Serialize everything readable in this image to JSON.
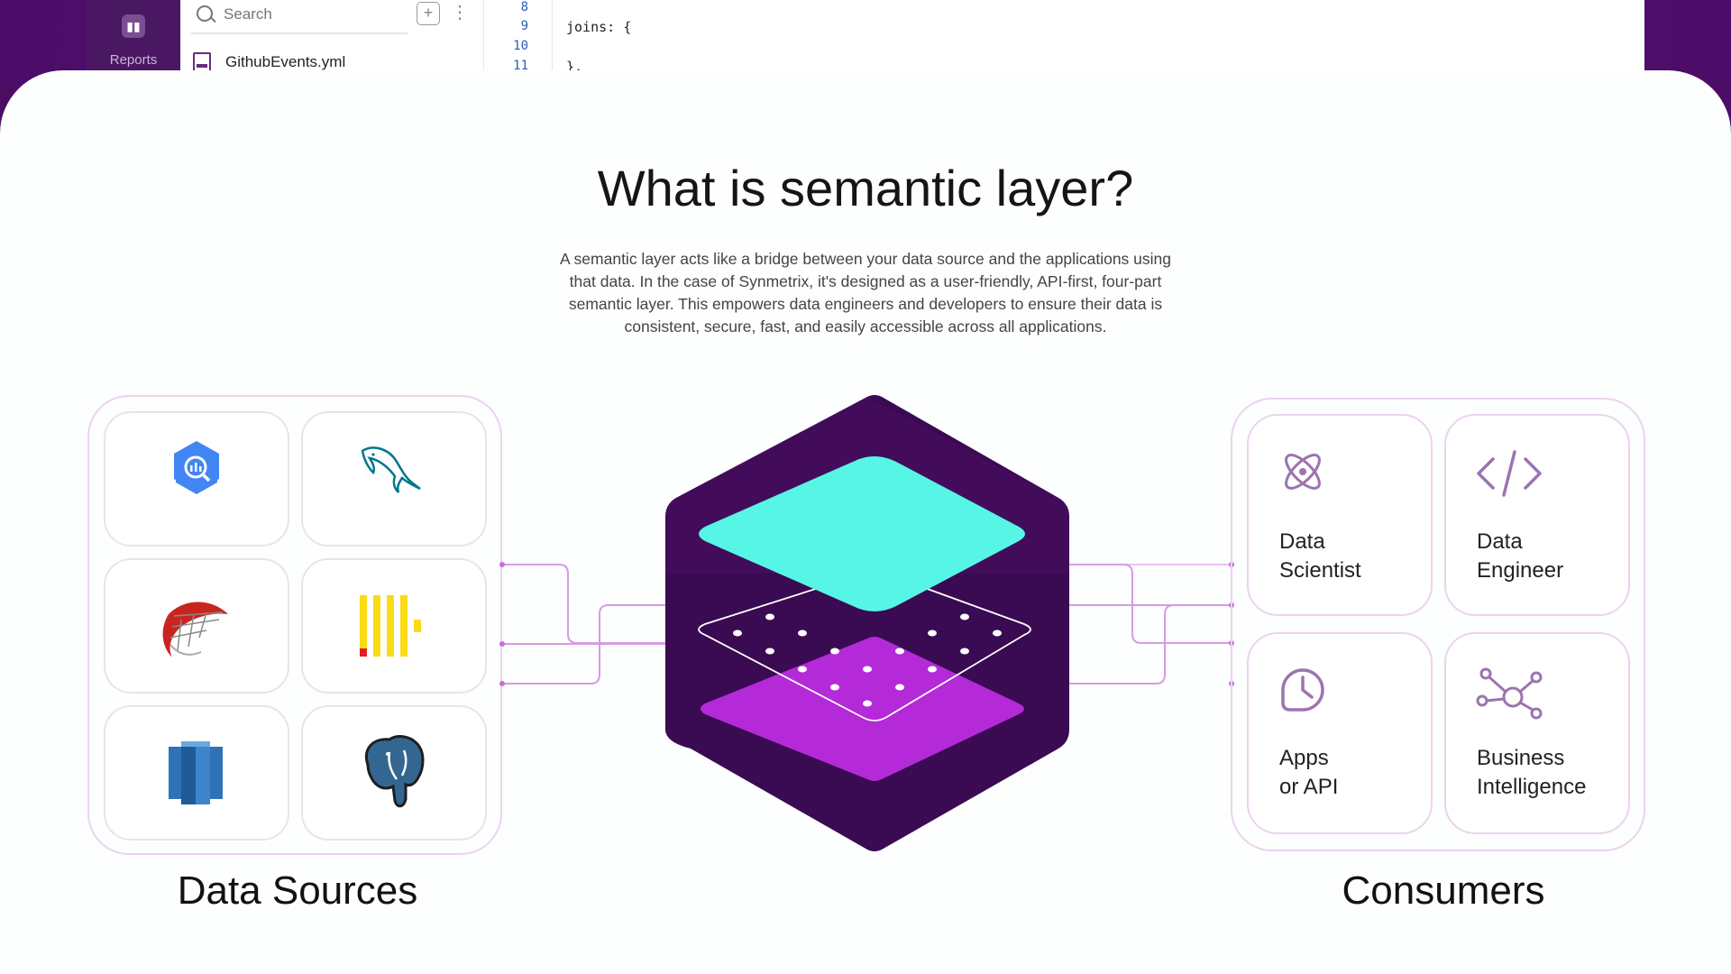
{
  "app": {
    "sidebar": {
      "reports_label": "Reports"
    },
    "search": {
      "placeholder": "Search"
    },
    "add_button": "+",
    "more_button": "⋮",
    "file": {
      "name": "GithubEvents.yml"
    },
    "editor": {
      "lines": [
        {
          "number": "8",
          "code": ""
        },
        {
          "number": "9",
          "code": "joins: {"
        },
        {
          "number": "10",
          "code": ""
        },
        {
          "number": "11",
          "code": "},"
        }
      ]
    }
  },
  "heading": "What is semantic layer?",
  "description": "A semantic layer acts like a bridge between your data source and the applications using that data. In the case of Synmetrix, it's designed as a user-friendly, API-first, four-part semantic layer. This empowers data engineers and developers to ensure their data is consistent, secure, fast, and easily accessible across all applications.",
  "data_sources": {
    "caption": "Data Sources",
    "icons": [
      "bigquery-icon",
      "mysql-icon",
      "sql-server-icon",
      "clickhouse-icon",
      "redshift-icon",
      "postgresql-icon"
    ]
  },
  "consumers": {
    "caption": "Consumers",
    "items": [
      {
        "icon": "atom-icon",
        "line1": "Data",
        "line2": "Scientist"
      },
      {
        "icon": "code-icon",
        "line1": "Data",
        "line2": "Engineer"
      },
      {
        "icon": "clock-icon",
        "line1": "Apps",
        "line2": "or API"
      },
      {
        "icon": "network-icon",
        "line1": "Business",
        "line2": "Intelligence"
      }
    ]
  },
  "colors": {
    "brand_purple": "#4a0d63",
    "hex_dark": "#3a0a52",
    "layer_top": "#57f5e6",
    "layer_bottom": "#b429d8",
    "connector": "#d79be4"
  }
}
